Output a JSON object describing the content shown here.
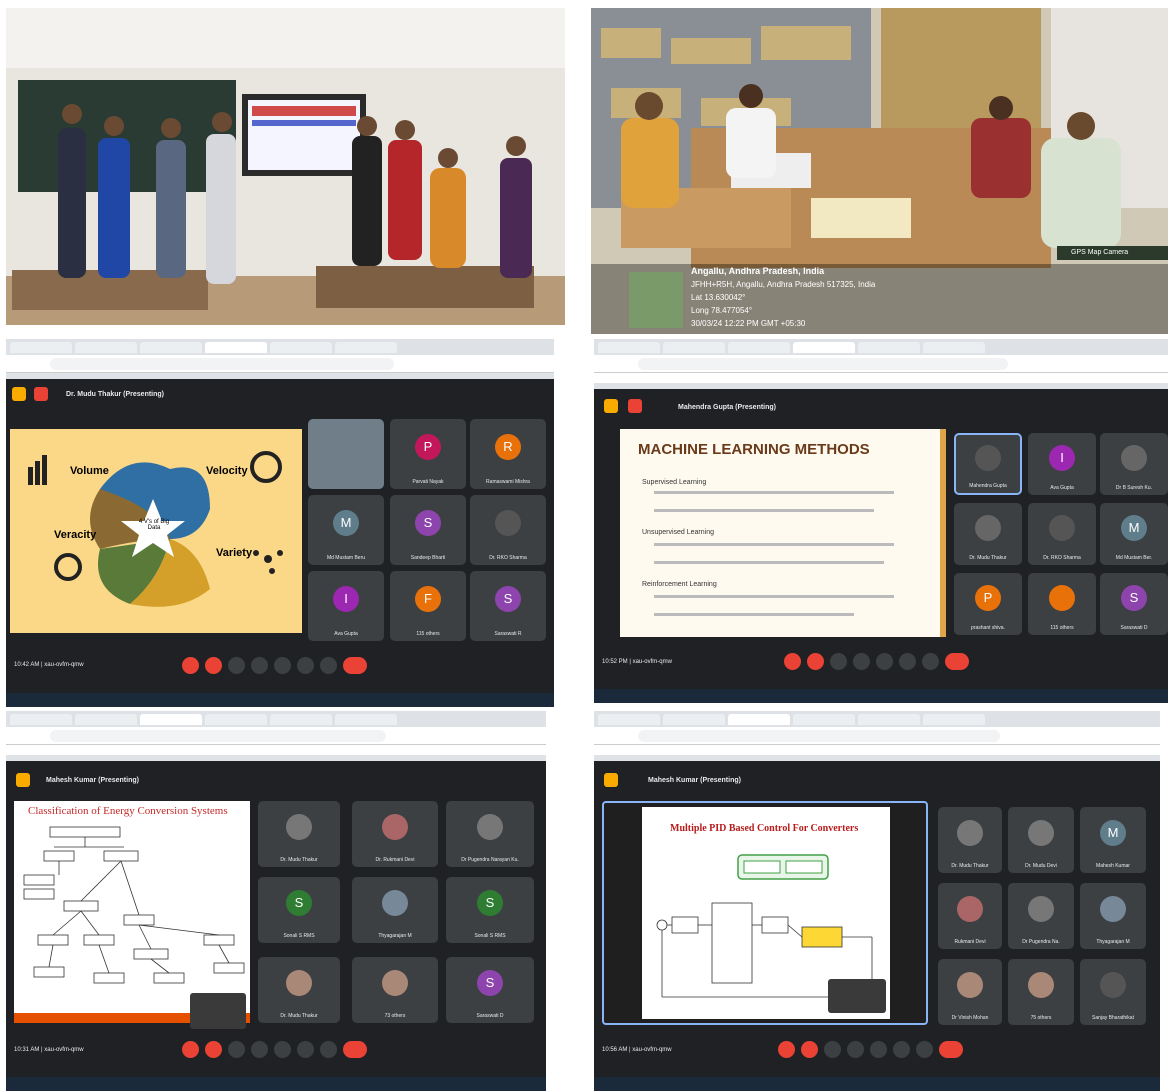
{
  "photo_top_right": {
    "geotag_location": "Angallu, Andhra Pradesh, India",
    "geotag_address": "JFHH+R5H, Angallu, Andhra Pradesh 517325, India",
    "geotag_lat": "Lat 13.630042°",
    "geotag_long": "Long 78.477054°",
    "geotag_datetime": "30/03/24 12:22 PM GMT +05:30",
    "camera_label": "GPS Map Camera"
  },
  "meet1": {
    "presenter": "Dr. Mudu Thakur (Presenting)",
    "slide_labels": [
      "Volume",
      "Velocity",
      "Veracity",
      "Variety"
    ],
    "slide_center": "4 V's of Big Data",
    "participants": [
      "",
      "Parvati Nayak",
      "Ramaswami Mishra",
      "Md Mustam Beru",
      "Sandeep Bharti",
      "Dr. RKO Sharma",
      "Ava Gupta",
      "115 others",
      "Saraswati R"
    ],
    "time": "10:42 AM",
    "code": "xau-ovfm-qmw"
  },
  "meet2": {
    "presenter": "Mahendra Gupta (Presenting)",
    "slide_title": "MACHINE LEARNING METHODS",
    "slide_bullets": [
      "Supervised Learning",
      "Unsupervised Learning",
      "Reinforcement Learning"
    ],
    "participants": [
      "Mahendra Gupta",
      "Ava Gupta",
      "Dr B Suresh Ku.",
      "Dr. Mudu Thakur",
      "Dr. RKO Sharma",
      "Md Mustam Ber.",
      "prashant shiva.",
      "115 others",
      "Saraswati D"
    ],
    "time": "10:52 PM",
    "code": "xau-ovfm-qmw"
  },
  "meet3": {
    "presenter": "Mahesh Kumar (Presenting)",
    "slide_title": "Classification of Energy Conversion Systems",
    "participants": [
      "Dr. Mudu Thakur",
      "Dr. Rukmani Devi",
      "Dr Pugendra Narayan Ku.",
      "Sonali S RMS",
      "Thyagarajan M",
      "Sonali S RMS",
      "Dr. Mudu Thakur",
      "73 others",
      "Saraswati D"
    ],
    "time": "10:31 AM",
    "code": "xau-ovfm-qmw"
  },
  "meet4": {
    "presenter": "Mahesh Kumar (Presenting)",
    "slide_title": "Multiple PID Based Control For Converters",
    "participants": [
      "Dr. Mudu Thakur",
      "Dr. Mudu Devi",
      "Mahesh Kumar",
      "Rukmani Devi",
      "Dr Pugendra Na.",
      "Thyagarajan M",
      "Dr Vinish Mohan",
      "75 others",
      "Sanjay Bharathikat"
    ],
    "time": "10:56 AM",
    "code": "xau-ovfm-qmw"
  },
  "colors": {
    "meet_bg": "#202124",
    "tile_bg": "#3c4043",
    "slide1_bg": "#fbd887",
    "end_call": "#ea4335"
  }
}
